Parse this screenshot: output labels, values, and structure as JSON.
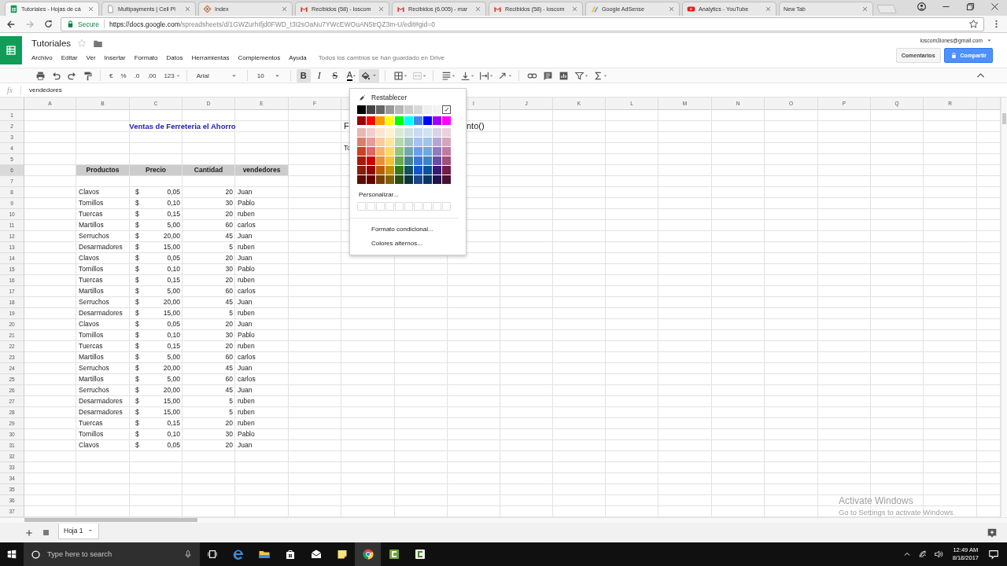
{
  "browser": {
    "tabs": [
      {
        "title": "Tutoriales - Hojas de cá",
        "kind": "sheets",
        "selected": true
      },
      {
        "title": "Multipayments | Cell Pl",
        "kind": "page",
        "selected": false
      },
      {
        "title": "Index",
        "kind": "index",
        "selected": false
      },
      {
        "title": "Recibidos (58) - loscom",
        "kind": "gmail",
        "selected": false
      },
      {
        "title": "Recibidos (6.005) - mar",
        "kind": "gmail",
        "selected": false
      },
      {
        "title": "Recibidos (58) - loscom",
        "kind": "gmail",
        "selected": false
      },
      {
        "title": "Google AdSense",
        "kind": "adsense",
        "selected": false
      },
      {
        "title": "Analytics - YouTube",
        "kind": "youtube",
        "selected": false
      },
      {
        "title": "New Tab",
        "kind": "blank",
        "selected": false
      }
    ]
  },
  "address_bar": {
    "security": "Secure",
    "url_host": "https://docs.google.com",
    "url_path": "/spreadsheets/d/1GWZurhIfjd0FWD_t3I2sOaNu7YWcEWOuAN5trQZ3m-U/edit#gid=0"
  },
  "document": {
    "title": "Tutoriales",
    "menus": [
      "Archivo",
      "Editar",
      "Ver",
      "Insertar",
      "Formato",
      "Datos",
      "Herramientas",
      "Complementos",
      "Ayuda"
    ],
    "save_status": "Todos los cambios se han guardado en Drive",
    "account": "loscom3lones@gmail.com",
    "comments_button": "Comentarios",
    "share_button": "Compartir"
  },
  "toolbar": {
    "currency": "€",
    "percent": "%",
    "decrease_decimals": ".0",
    "increase_decimals": ".00",
    "more_formats": "123",
    "font": "Arial",
    "font_size": "10",
    "bold": {
      "label": "B",
      "pressed": true
    },
    "italic": {
      "label": "I",
      "pressed": false
    },
    "strikethrough": {
      "label": "S",
      "pressed": false
    },
    "text_color": {
      "label": "A"
    },
    "fill_color": {
      "pressed": true
    }
  },
  "formula_bar": {
    "label": "fx",
    "value": "vendedores"
  },
  "sheet": {
    "columns": [
      "A",
      "B",
      "C",
      "D",
      "E",
      "F",
      null,
      null,
      "I",
      "J",
      "K",
      "L",
      "M",
      "N",
      "O",
      "P",
      "Q",
      "R"
    ],
    "row_numbers": [
      {
        "label": "1",
        "selected": false
      },
      {
        "label": "2",
        "selected": false
      },
      {
        "label": "3",
        "selected": false
      },
      {
        "label": "4",
        "selected": false
      },
      {
        "label": "5",
        "selected": false
      },
      {
        "label": "6",
        "selected": true
      },
      {
        "label": "7",
        "selected": false
      },
      {
        "label": "8",
        "selected": false
      },
      {
        "label": "9",
        "selected": false
      },
      {
        "label": "10",
        "selected": false
      },
      {
        "label": "11",
        "selected": false
      },
      {
        "label": "12",
        "selected": false
      },
      {
        "label": "13",
        "selected": false
      },
      {
        "label": "14",
        "selected": false
      },
      {
        "label": "15",
        "selected": false
      },
      {
        "label": "16",
        "selected": false
      },
      {
        "label": "17",
        "selected": false
      },
      {
        "label": "18",
        "selected": false
      },
      {
        "label": "19",
        "selected": false
      },
      {
        "label": "20",
        "selected": false
      },
      {
        "label": "21",
        "selected": false
      },
      {
        "label": "22",
        "selected": false
      },
      {
        "label": "23",
        "selected": false
      },
      {
        "label": "24",
        "selected": false
      },
      {
        "label": "25",
        "selected": false
      },
      {
        "label": "26",
        "selected": false
      },
      {
        "label": "27",
        "selected": false
      },
      {
        "label": "28",
        "selected": false
      },
      {
        "label": "29",
        "selected": false
      },
      {
        "label": "30",
        "selected": false
      },
      {
        "label": "31",
        "selected": false
      },
      {
        "label": "32",
        "selected": false
      },
      {
        "label": "33",
        "selected": false
      },
      {
        "label": "34",
        "selected": false
      },
      {
        "label": "35",
        "selected": false
      },
      {
        "label": "36",
        "selected": false
      },
      {
        "label": "37",
        "selected": false
      }
    ],
    "title": "Ventas de Ferreteria el Ahorro",
    "side_texts": [
      "F",
      "nto()",
      "To"
    ],
    "headers": [
      "Productos",
      "Precio",
      "Cantidad",
      "vendedores"
    ],
    "rows": [
      {
        "product": "Clavos",
        "currency": "$",
        "price": "0,05",
        "quantity": "20",
        "seller": "Juan"
      },
      {
        "product": "Tornillos",
        "currency": "$",
        "price": "0,10",
        "quantity": "30",
        "seller": "Pablo"
      },
      {
        "product": "Tuercas",
        "currency": "$",
        "price": "0,15",
        "quantity": "20",
        "seller": "ruben"
      },
      {
        "product": "Martillos",
        "currency": "$",
        "price": "5,00",
        "quantity": "60",
        "seller": "carlos"
      },
      {
        "product": "Serruchos",
        "currency": "$",
        "price": "20,00",
        "quantity": "45",
        "seller": "Juan"
      },
      {
        "product": "Desarmadores",
        "currency": "$",
        "price": "15,00",
        "quantity": "5",
        "seller": "ruben"
      },
      {
        "product": "Clavos",
        "currency": "$",
        "price": "0,05",
        "quantity": "20",
        "seller": "Juan"
      },
      {
        "product": "Tornillos",
        "currency": "$",
        "price": "0,10",
        "quantity": "30",
        "seller": "Pablo"
      },
      {
        "product": "Tuercas",
        "currency": "$",
        "price": "0,15",
        "quantity": "20",
        "seller": "ruben"
      },
      {
        "product": "Martillos",
        "currency": "$",
        "price": "5,00",
        "quantity": "60",
        "seller": "carlos"
      },
      {
        "product": "Serruchos",
        "currency": "$",
        "price": "20,00",
        "quantity": "45",
        "seller": "Juan"
      },
      {
        "product": "Desarmadores",
        "currency": "$",
        "price": "15,00",
        "quantity": "5",
        "seller": "ruben"
      },
      {
        "product": "Clavos",
        "currency": "$",
        "price": "0,05",
        "quantity": "20",
        "seller": "Juan"
      },
      {
        "product": "Tornillos",
        "currency": "$",
        "price": "0,10",
        "quantity": "30",
        "seller": "Pablo"
      },
      {
        "product": "Tuercas",
        "currency": "$",
        "price": "0,15",
        "quantity": "20",
        "seller": "ruben"
      },
      {
        "product": "Martillos",
        "currency": "$",
        "price": "5,00",
        "quantity": "60",
        "seller": "carlos"
      },
      {
        "product": "Serruchos",
        "currency": "$",
        "price": "20,00",
        "quantity": "45",
        "seller": "Juan"
      },
      {
        "product": "Martillos",
        "currency": "$",
        "price": "5,00",
        "quantity": "60",
        "seller": "carlos"
      },
      {
        "product": "Serruchos",
        "currency": "$",
        "price": "20,00",
        "quantity": "45",
        "seller": "Juan"
      },
      {
        "product": "Desarmadores",
        "currency": "$",
        "price": "15,00",
        "quantity": "5",
        "seller": "ruben"
      },
      {
        "product": "Desarmadores",
        "currency": "$",
        "price": "15,00",
        "quantity": "5",
        "seller": "ruben"
      },
      {
        "product": "Tuercas",
        "currency": "$",
        "price": "0,15",
        "quantity": "20",
        "seller": "ruben"
      },
      {
        "product": "Tornillos",
        "currency": "$",
        "price": "0,10",
        "quantity": "30",
        "seller": "Pablo"
      },
      {
        "product": "Clavos",
        "currency": "$",
        "price": "0,05",
        "quantity": "20",
        "seller": "Juan"
      }
    ]
  },
  "color_menu": {
    "reset": "Restablecer",
    "palette": [
      [
        {
          "color": "#000000",
          "selected": false
        },
        {
          "color": "#434343",
          "selected": false
        },
        {
          "color": "#666666",
          "selected": false
        },
        {
          "color": "#999999",
          "selected": false
        },
        {
          "color": "#b7b7b7",
          "selected": false
        },
        {
          "color": "#cccccc",
          "selected": false
        },
        {
          "color": "#d9d9d9",
          "selected": false
        },
        {
          "color": "#efefef",
          "selected": false
        },
        {
          "color": "#f3f3f3",
          "selected": false
        },
        {
          "color": "#ffffff",
          "selected": true
        }
      ],
      [
        {
          "color": "#980000",
          "selected": false
        },
        {
          "color": "#ff0000",
          "selected": false
        },
        {
          "color": "#ff9900",
          "selected": false
        },
        {
          "color": "#ffff00",
          "selected": false
        },
        {
          "color": "#00ff00",
          "selected": false
        },
        {
          "color": "#00ffff",
          "selected": false
        },
        {
          "color": "#4a86e8",
          "selected": false
        },
        {
          "color": "#0000ff",
          "selected": false
        },
        {
          "color": "#9900ff",
          "selected": false
        },
        {
          "color": "#ff00ff",
          "selected": false
        }
      ],
      [
        {
          "color": "#e6b8af",
          "selected": false
        },
        {
          "color": "#f4cccc",
          "selected": false
        },
        {
          "color": "#fce5cd",
          "selected": false
        },
        {
          "color": "#fff2cc",
          "selected": false
        },
        {
          "color": "#d9ead3",
          "selected": false
        },
        {
          "color": "#d0e0e3",
          "selected": false
        },
        {
          "color": "#c9daf8",
          "selected": false
        },
        {
          "color": "#cfe2f3",
          "selected": false
        },
        {
          "color": "#d9d2e9",
          "selected": false
        },
        {
          "color": "#ead1dc",
          "selected": false
        }
      ],
      [
        {
          "color": "#dd7e6b",
          "selected": false
        },
        {
          "color": "#ea9999",
          "selected": false
        },
        {
          "color": "#f9cb9c",
          "selected": false
        },
        {
          "color": "#ffe599",
          "selected": false
        },
        {
          "color": "#b6d7a8",
          "selected": false
        },
        {
          "color": "#a2c4c9",
          "selected": false
        },
        {
          "color": "#a4c2f4",
          "selected": false
        },
        {
          "color": "#9fc5e8",
          "selected": false
        },
        {
          "color": "#b4a7d6",
          "selected": false
        },
        {
          "color": "#d5a6bd",
          "selected": false
        }
      ],
      [
        {
          "color": "#cc4125",
          "selected": false
        },
        {
          "color": "#e06666",
          "selected": false
        },
        {
          "color": "#f6b26b",
          "selected": false
        },
        {
          "color": "#ffd966",
          "selected": false
        },
        {
          "color": "#93c47d",
          "selected": false
        },
        {
          "color": "#76a5af",
          "selected": false
        },
        {
          "color": "#6d9eeb",
          "selected": false
        },
        {
          "color": "#6fa8dc",
          "selected": false
        },
        {
          "color": "#8e7cc3",
          "selected": false
        },
        {
          "color": "#c27ba0",
          "selected": false
        }
      ],
      [
        {
          "color": "#a61c00",
          "selected": false
        },
        {
          "color": "#cc0000",
          "selected": false
        },
        {
          "color": "#e69138",
          "selected": false
        },
        {
          "color": "#f1c232",
          "selected": false
        },
        {
          "color": "#6aa84f",
          "selected": false
        },
        {
          "color": "#45818e",
          "selected": false
        },
        {
          "color": "#3c78d8",
          "selected": false
        },
        {
          "color": "#3d85c6",
          "selected": false
        },
        {
          "color": "#674ea7",
          "selected": false
        },
        {
          "color": "#a64d79",
          "selected": false
        }
      ],
      [
        {
          "color": "#85200c",
          "selected": false
        },
        {
          "color": "#990000",
          "selected": false
        },
        {
          "color": "#b45f06",
          "selected": false
        },
        {
          "color": "#bf9000",
          "selected": false
        },
        {
          "color": "#38761d",
          "selected": false
        },
        {
          "color": "#134f5c",
          "selected": false
        },
        {
          "color": "#1155cc",
          "selected": false
        },
        {
          "color": "#0b5394",
          "selected": false
        },
        {
          "color": "#351c75",
          "selected": false
        },
        {
          "color": "#741b47",
          "selected": false
        }
      ],
      [
        {
          "color": "#5b0f00",
          "selected": false
        },
        {
          "color": "#660000",
          "selected": false
        },
        {
          "color": "#783f04",
          "selected": false
        },
        {
          "color": "#7f6000",
          "selected": false
        },
        {
          "color": "#274e13",
          "selected": false
        },
        {
          "color": "#0c343d",
          "selected": false
        },
        {
          "color": "#1c4587",
          "selected": false
        },
        {
          "color": "#073763",
          "selected": false
        },
        {
          "color": "#20124d",
          "selected": false
        },
        {
          "color": "#4c1130",
          "selected": false
        }
      ]
    ],
    "custom_label": "Personalizar...",
    "options": [
      "Formato condicional...",
      "Colores alternos..."
    ]
  },
  "sheet_tabs": [
    {
      "label": "Hoja 1",
      "selected": true
    }
  ],
  "taskbar": {
    "search_placeholder": "Type here to search",
    "apps": [
      {
        "kind": "edge",
        "active": false
      },
      {
        "kind": "explorer",
        "active": false
      },
      {
        "kind": "store",
        "active": false
      },
      {
        "kind": "mail",
        "active": false
      },
      {
        "kind": "sticky",
        "active": false
      },
      {
        "kind": "chrome",
        "active": true
      },
      {
        "kind": "camtasia",
        "active": false
      },
      {
        "kind": "camtasia-light",
        "active": false
      }
    ],
    "time": "12:49 AM",
    "date": "8/18/2017"
  },
  "activation_notice": {
    "title": "Activate Windows",
    "text": "Go to Settings to activate Windows."
  }
}
